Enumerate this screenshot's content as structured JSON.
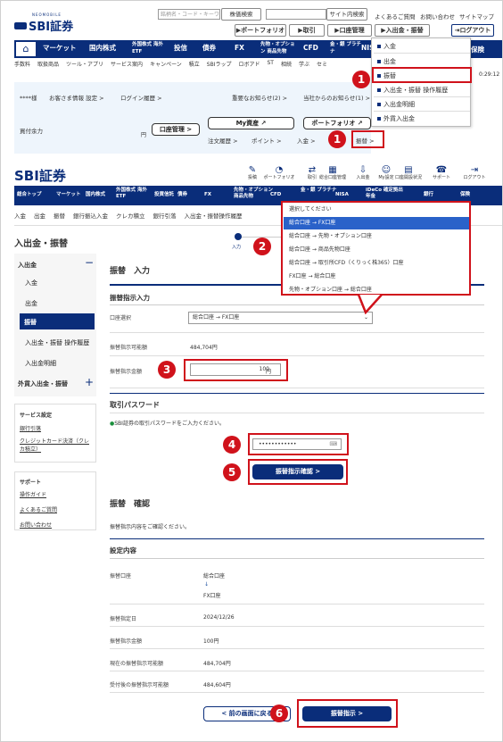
{
  "top": {
    "search_placeholder": "銘柄名・コード・キーワード",
    "stock_search": "株価検索",
    "site_search": "サイト内検索",
    "faq": "よくあるご質問",
    "contact": "お問い合わせ",
    "sitemap": "サイトマップ",
    "logo": "SBI証券",
    "logo_small": "NEOMOBILE"
  },
  "topbar": {
    "portfolio": "▶ポートフォリオ",
    "trade": "▶取引",
    "account": "▶口座管理",
    "deposit": "▶入出金・振替",
    "logout": "ログアウト"
  },
  "nav": [
    "マーケット",
    "国内株式",
    "外国株式 海外ETF",
    "投信",
    "債券",
    "FX",
    "先物・オプション 商品先物",
    "CFD",
    "金・銀 プラチナ",
    "NISA"
  ],
  "nav_right": "保険",
  "subnav": [
    "手数料",
    "取扱商品",
    "ツール・アプリ",
    "サービス案内",
    "キャンペーン",
    "積立",
    "SBIラップ",
    "ロボアド",
    "ST",
    "相続",
    "学ぶ",
    "セミ"
  ],
  "time": "0:29:12",
  "dropdown1": [
    "入金",
    "出金",
    "振替",
    "入出金・振替 操作履歴",
    "入出金明細",
    "外貨入出金"
  ],
  "info": {
    "user": "****様",
    "settings": "お客さま情報 設定 >",
    "login_history": "ログイン履歴 >",
    "important": "重要なお知らせ(2) >",
    "notice": "当社からのお知らせ(1) >",
    "buying_power": "買付余力",
    "yen": "円",
    "account_mgmt": "口座管理 >",
    "my_assets": "My資産",
    "portfolio": "ポートフォリオ",
    "order_history": "注文履歴 >",
    "point": "ポイント >",
    "deposit": "入金 >",
    "transfer": "振替 >"
  },
  "header2": {
    "logo": "SBI証券",
    "icons": [
      "投稿",
      "ポートフォリオ",
      "取引",
      "総合口座管理",
      "入出金",
      "My設定",
      "口座開設状況",
      "サポート",
      "ログアウト"
    ]
  },
  "nav2": [
    "総合トップ",
    "マーケット",
    "国内株式",
    "外国株式 海外ETF",
    "投資信託",
    "債券",
    "FX",
    "先物・オプション 商品先物",
    "CFD",
    "金・銀 プラチナ",
    "NISA",
    "iDeCo 確定拠出年金",
    "銀行",
    "保険"
  ],
  "subnav2": [
    "入金",
    "出金",
    "振替",
    "銀行振込入金",
    "クレカ積立",
    "銀行引落",
    "入出金・振替操作履歴"
  ],
  "side": {
    "title": "入出金・振替",
    "section": "入出金",
    "items": [
      "入金",
      "出金",
      "振替",
      "入出金・振替 操作履歴",
      "入出金明細"
    ],
    "foreign": "外貨入出金・振替",
    "services_title": "サービス設定",
    "services": [
      "銀行引落",
      "クレジットカード決済（クレカ積立）"
    ],
    "support_title": "サポート",
    "support": [
      "操作ガイド",
      "よくあるご質問",
      "お問い合わせ"
    ]
  },
  "steps": {
    "input": "入力"
  },
  "form": {
    "title": "振替　入力",
    "section": "振替指示入力",
    "source_label": "口座選択",
    "source_value": "総合口座 → FX口座",
    "available_label": "振替指示可能額",
    "available_value": "484,704円",
    "amount_label": "振替指示金額",
    "amount_value": "100",
    "amount_unit": "円",
    "pw_title": "取引パスワード",
    "pw_note": "SBI証券の取引パスワードをご入力ください。",
    "pw_value": "••••••••••••",
    "confirm_btn": "振替指示確認 >"
  },
  "dropdown2": [
    "選択してください",
    "総合口座 → FX口座",
    "総合口座 → 先物・オプション口座",
    "総合口座 → 商品先物口座",
    "総合口座 → 取引所CFD（くりっく株365）口座",
    "FX口座 → 総合口座",
    "先物・オプション口座 → 総合口座"
  ],
  "confirm": {
    "title": "振替　確認",
    "note": "振替指示内容をご確認ください。",
    "section": "設定内容",
    "rows": [
      {
        "label": "振替口座",
        "v1": "総合口座",
        "arrow": "↓",
        "v2": "FX口座"
      },
      {
        "label": "振替指定日",
        "v1": "2024/12/26"
      },
      {
        "label": "振替指示金額",
        "v1": "100円"
      },
      {
        "label": "現在の振替指示可能額",
        "v1": "484,704円"
      },
      {
        "label": "受付後の振替指示可能額",
        "v1": "484,604円"
      }
    ],
    "back_btn": "< 前の画面に戻る",
    "submit_btn": "振替指示 >"
  },
  "markers": [
    "1",
    "1",
    "2",
    "3",
    "4",
    "5",
    "6"
  ],
  "colors": {
    "navy": "#0a2d7a",
    "red": "#d0121b",
    "lightblue": "#eaf3fb"
  }
}
